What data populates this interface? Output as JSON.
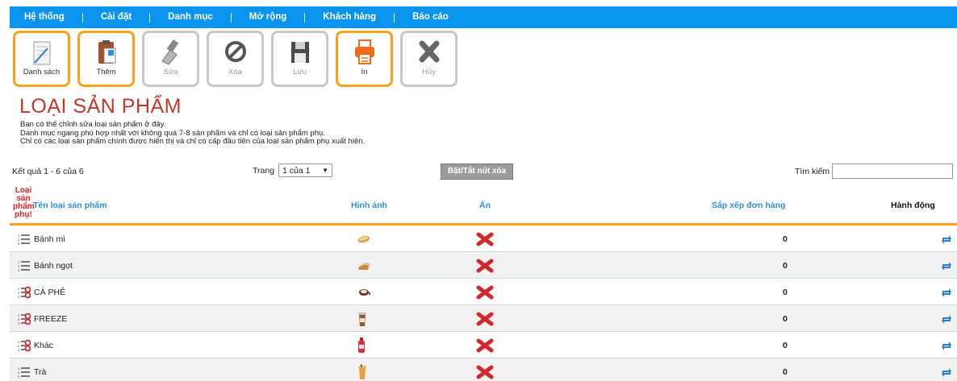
{
  "nav": {
    "items": [
      "Hệ thống",
      "Cài đặt",
      "Danh mục",
      "Mở rộng",
      "Khách hàng",
      "Báo cáo"
    ]
  },
  "toolbar": {
    "list": "Danh sách",
    "add": "Thêm",
    "edit": "Sửa",
    "delete": "Xóa",
    "save": "Lưu",
    "print": "In",
    "cancel": "Hủy"
  },
  "page": {
    "title": "LOẠI SẢN PHẨM",
    "desc_lines": [
      "Bạn có thể chỉnh sửa loại sản phẩm ở đây.",
      "Danh mục ngang phù hợp nhất với không quá 7-8 sản phẩm và chỉ có loại sản phẩm phụ.",
      "Chỉ có các loại sản phẩm chính được hiển thị và chỉ có cấp đầu tiên của loại sản phẩm phụ xuất hiện."
    ]
  },
  "controls": {
    "results": "Kết quả 1 - 6 của 6",
    "page_label": "Trang",
    "page_value": "1 của 1",
    "toggle_delete": "Bật/Tắt nút xóa",
    "search_label": "Tìm kiếm",
    "search_value": ""
  },
  "table": {
    "headers": {
      "sub": "Loại sản phẩm phụ!",
      "name": "Tên loại sản phẩm",
      "image": "Hình ảnh",
      "hidden": "Ẩn",
      "order": "Sắp xếp đơn hàng",
      "action": "Hành động"
    },
    "rows": [
      {
        "icon": "list-icon",
        "name": "Bánh mì",
        "image": "sandwich-image",
        "hidden_icon": "red-x-icon",
        "order": "0"
      },
      {
        "icon": "list-icon",
        "name": "Bánh ngọt",
        "image": "cake-image",
        "hidden_icon": "red-x-icon",
        "order": "0"
      },
      {
        "icon": "sublist-icon",
        "name": "CÀ PHÊ",
        "image": "coffee-image",
        "hidden_icon": "red-x-icon",
        "order": "0"
      },
      {
        "icon": "sublist-icon",
        "name": "FREEZE",
        "image": "freeze-drink-image",
        "hidden_icon": "red-x-icon",
        "order": "0"
      },
      {
        "icon": "sublist-icon",
        "name": "Khác",
        "image": "bottle-image",
        "hidden_icon": "red-x-icon",
        "order": "0"
      },
      {
        "icon": "list-icon",
        "name": "Trà",
        "image": "tea-image",
        "hidden_icon": "red-x-icon",
        "order": "0"
      }
    ]
  },
  "colors": {
    "nav_bg": "#0b94ee",
    "accent_orange": "#f7a31b",
    "title_red": "#c0392b",
    "header_blue": "#2f8fd8",
    "delete_red": "#d0282c"
  }
}
